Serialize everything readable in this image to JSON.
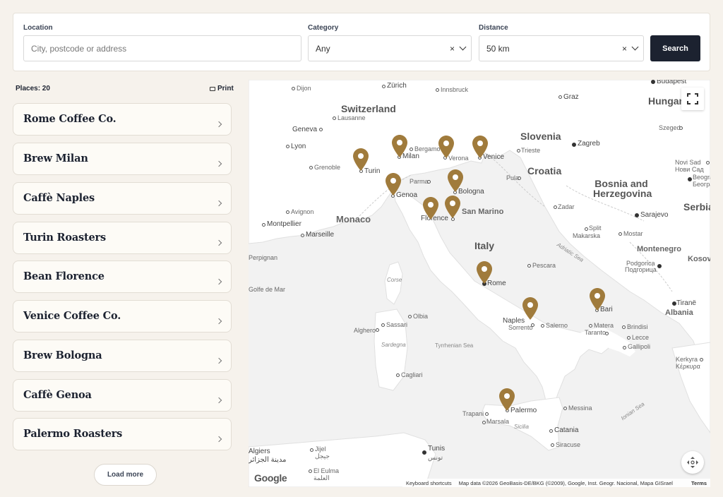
{
  "search": {
    "location_label": "Location",
    "location_placeholder": "City, postcode or address",
    "category_label": "Category",
    "category_value": "Any",
    "distance_label": "Distance",
    "distance_value": "50 km",
    "clear_glyph": "×",
    "search_button": "Search"
  },
  "sidebar": {
    "places_count": "Places: 20",
    "print_label": "Print",
    "places": [
      "Rome Coffee Co.",
      "Brew Milan",
      "Caffè Naples",
      "Turin Roasters",
      "Bean Florence",
      "Venice Coffee Co.",
      "Brew Bologna",
      "Caffè Genoa",
      "Palermo Roasters"
    ],
    "load_more": "Load more"
  },
  "map": {
    "pin_color": "#a07b3c",
    "water_color": "#f2f2f2",
    "land_color": "#ffffff",
    "labels": {
      "countries": [
        "Switzerland",
        "Slovenia",
        "Croatia",
        "Bosnia and Herzegovina",
        "Italy",
        "Montenegro",
        "Albania",
        "Monaco",
        "San Marino",
        "Hungar",
        "Serbia",
        "Kosov"
      ],
      "cities": [
        "Zürich",
        "Dijon",
        "Innsbruck",
        "Graz",
        "Budapest",
        "Lausanne",
        "Geneva",
        "Lyon",
        "Grenoble",
        "Bergamo",
        "Milan",
        "Verona",
        "Venice",
        "Trieste",
        "Zagreb",
        "Szeged",
        "Turin",
        "Parma",
        "Genoa",
        "Bologna",
        "Pula",
        "Novi Sad",
        "Нови Сад",
        "Beograd",
        "Београд",
        "Avignon",
        "Montpellier",
        "Marseille",
        "Florence",
        "Zadar",
        "Sarajevo",
        "Split",
        "Makarska",
        "Mostar",
        "Perpignan",
        "Pescara",
        "Podgorica",
        "Подгорица",
        "Rome",
        "Corse",
        "Bari",
        "Tiranë",
        "Olbia",
        "Naples",
        "Sorrento",
        "Salerno",
        "Matera",
        "Taranto",
        "Brindisi",
        "Lecce",
        "Gallipoli",
        "Sassari",
        "Alghero",
        "Sardegna",
        "Cagliari",
        "Kerkyra",
        "Κέρκυρα",
        "Palermo",
        "Messina",
        "Trapani",
        "Marsala",
        "Sicilia",
        "Catania",
        "Siracuse",
        "Tunis",
        "تونس",
        "Algiers",
        "مدينة الجزائر",
        "Jijel",
        "جيجل",
        "El Eulma",
        "العلمة"
      ],
      "seas": [
        "Adriatic Sea",
        "Tyrrhenian Sea",
        "Ionian Sea",
        "Golfe de Mar"
      ]
    },
    "pins": [
      "Milan",
      "Verona",
      "Venice",
      "Turin",
      "Genoa",
      "Bologna",
      "Florence",
      "San Marino",
      "Rome",
      "Naples",
      "Bari",
      "Palermo"
    ],
    "google_logo": "Google",
    "attribution": {
      "shortcuts": "Keyboard shortcuts",
      "data": "Map data ©2026 GeoBasis-DE/BKG (©2009), Google, Inst. Geogr. Nacional, Mapa GISrael",
      "terms": "Terms"
    }
  }
}
